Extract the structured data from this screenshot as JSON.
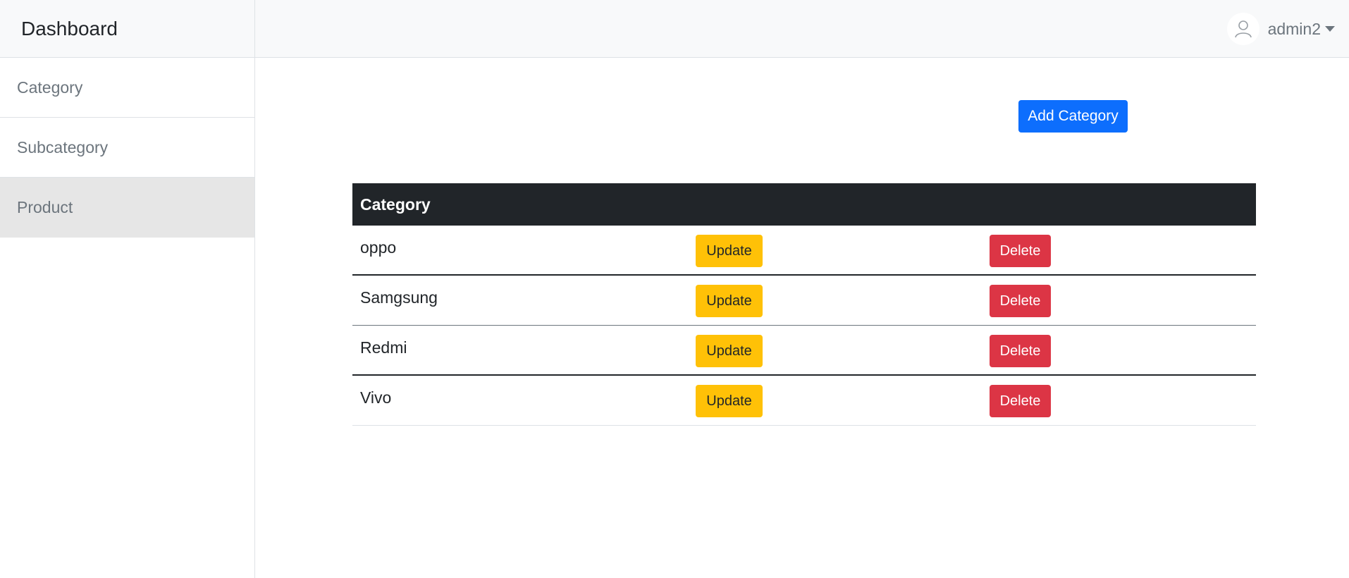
{
  "sidebar": {
    "brand": "Dashboard",
    "items": [
      {
        "label": "Category",
        "active": false
      },
      {
        "label": "Subcategory",
        "active": false
      },
      {
        "label": "Product",
        "active": true
      }
    ]
  },
  "topbar": {
    "username": "admin2",
    "avatar_icon": "user-avatar-icon",
    "caret_icon": "caret-down-icon"
  },
  "main": {
    "add_button_label": "Add Category",
    "table": {
      "header": "Category",
      "rows": [
        {
          "name": "oppo",
          "update_label": "Update",
          "delete_label": "Delete"
        },
        {
          "name": "Samgsung",
          "update_label": "Update",
          "delete_label": "Delete"
        },
        {
          "name": "Redmi",
          "update_label": "Update",
          "delete_label": "Delete"
        },
        {
          "name": "Vivo",
          "update_label": "Update",
          "delete_label": "Delete"
        }
      ]
    }
  },
  "colors": {
    "primary": "#0d6efd",
    "warning": "#ffc107",
    "danger": "#dc3545",
    "table_header": "#212529",
    "sidebar_active": "#e6e6e6"
  }
}
